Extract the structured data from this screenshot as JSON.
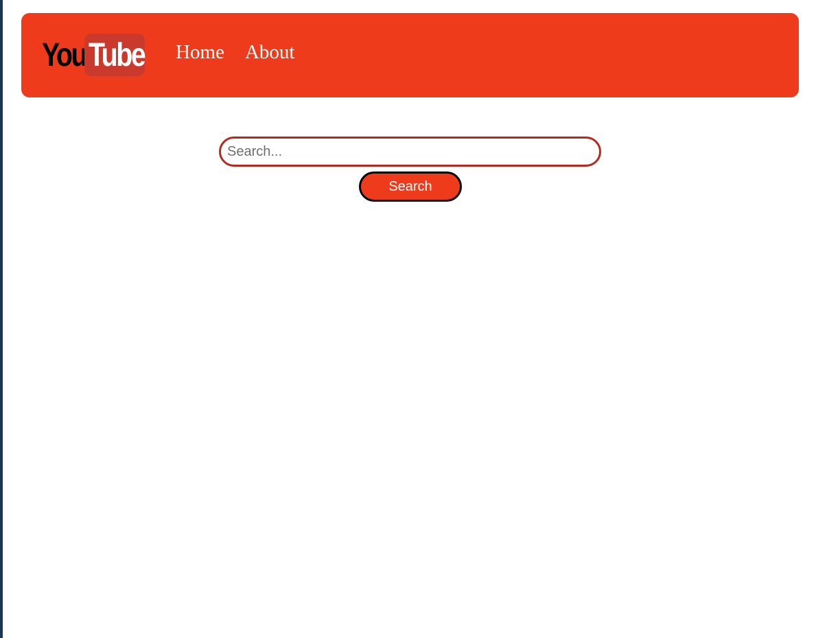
{
  "header": {
    "logo": {
      "word1": "You",
      "word2": "Tube"
    },
    "nav": [
      {
        "label": "Home"
      },
      {
        "label": "About"
      }
    ]
  },
  "search": {
    "value": "",
    "placeholder": "Search...",
    "button_label": "Search"
  },
  "colors": {
    "brand": "#ee3b1c",
    "logo_box": "#c93a2c",
    "input_border": "#b42a1e",
    "left_edge": "#1c3557"
  }
}
